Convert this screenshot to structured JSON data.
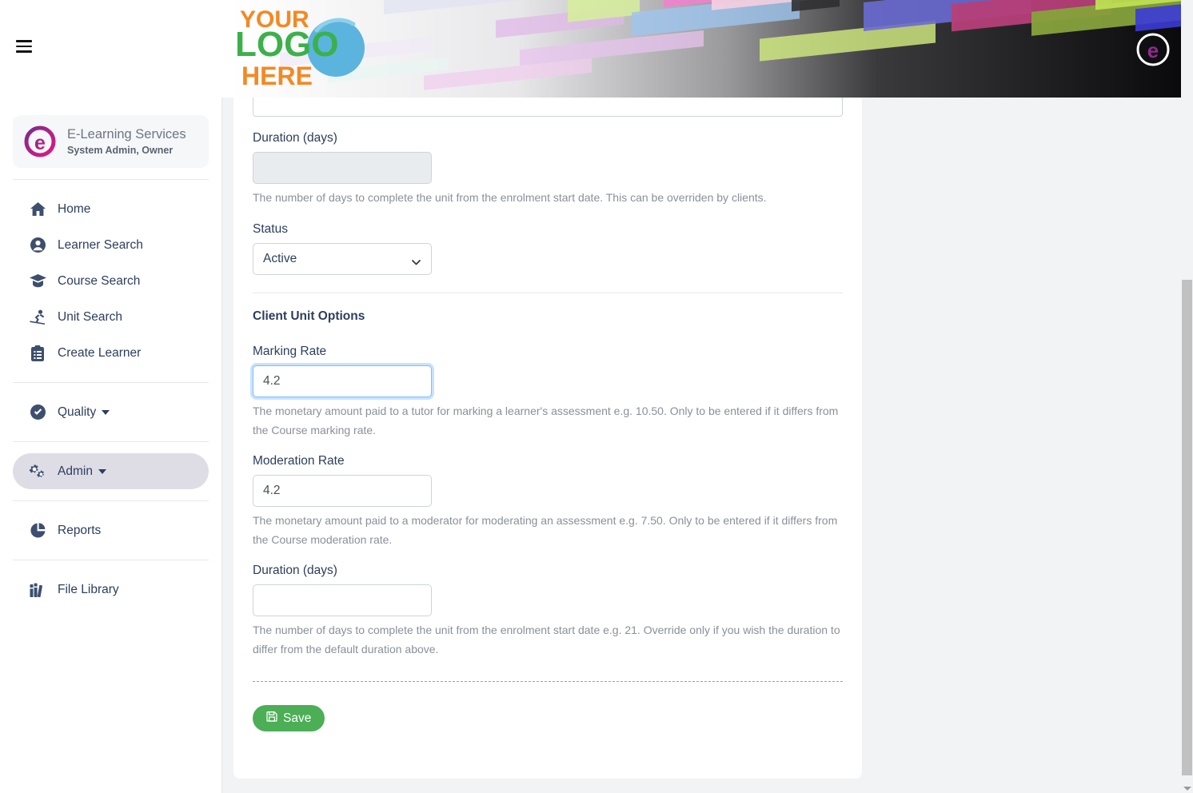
{
  "header": {
    "menu_icon": "hamburger-icon",
    "logo_line1": "YOUR",
    "logo_line2": "LOGO",
    "logo_line3": "HERE",
    "badge_letter": "e",
    "logo_orange": "#f28924",
    "logo_green": "#3cb04a",
    "logo_blue": "#5bb4dd"
  },
  "sidebar": {
    "profile": {
      "name": "E-Learning Services",
      "role": "System Admin, Owner",
      "avatar_icon": "e-logo-icon"
    },
    "items": [
      {
        "label": "Home",
        "icon": "home-icon",
        "active": false,
        "caret": false
      },
      {
        "label": "Learner Search",
        "icon": "user-circle-icon",
        "active": false,
        "caret": false
      },
      {
        "label": "Course Search",
        "icon": "graduation-cap-icon",
        "active": false,
        "caret": false
      },
      {
        "label": "Unit Search",
        "icon": "skier-icon",
        "active": false,
        "caret": false
      },
      {
        "label": "Create Learner",
        "icon": "clipboard-icon",
        "active": false,
        "caret": false
      },
      {
        "label": "Quality",
        "icon": "check-circle-icon",
        "active": false,
        "caret": true
      },
      {
        "label": "Admin",
        "icon": "gears-icon",
        "active": true,
        "caret": true
      },
      {
        "label": "Reports",
        "icon": "pie-chart-icon",
        "active": false,
        "caret": false
      },
      {
        "label": "File Library",
        "icon": "books-icon",
        "active": false,
        "caret": false
      }
    ]
  },
  "main": {
    "duration_label": "Duration (days)",
    "duration_value": "",
    "duration_help": "The number of days to complete the unit from the enrolment start date. This can be overriden by clients.",
    "status_label": "Status",
    "status_value": "Active",
    "status_options": [
      "Active"
    ],
    "section_title": "Client Unit Options",
    "marking_rate_label": "Marking Rate",
    "marking_rate_value": "4.2",
    "marking_rate_help": "The monetary amount paid to a tutor for marking a learner's assessment e.g. 10.50. Only to be entered if it differs from the Course marking rate.",
    "moderation_rate_label": "Moderation Rate",
    "moderation_rate_value": "4.2",
    "moderation_rate_help": "The monetary amount paid to a moderator for moderating an assessment e.g. 7.50. Only to be entered if it differs from the Course moderation rate.",
    "client_duration_label": "Duration (days)",
    "client_duration_value": "",
    "client_duration_help": "The number of days to complete the unit from the enrolment start date e.g. 21. Override only if you wish the duration to differ from the default duration above.",
    "save_label": "Save",
    "save_icon": "floppy-disk-icon",
    "save_color": "#4cae55"
  }
}
